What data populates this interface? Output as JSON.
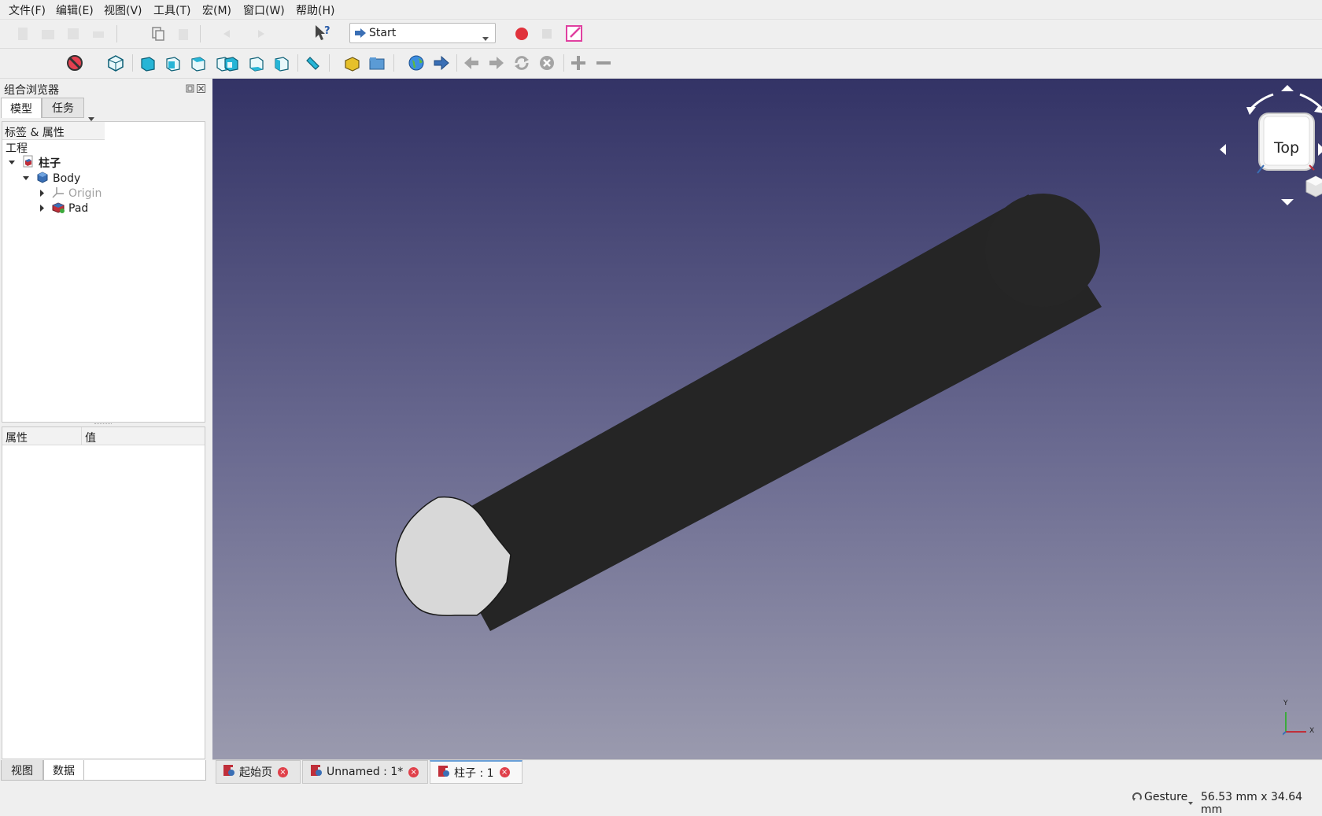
{
  "menu": [
    "文件(F)",
    "编辑(E)",
    "视图(V)",
    "工具(T)",
    "宏(M)",
    "窗口(W)",
    "帮助(H)"
  ],
  "toolbar": {
    "workbench": "Start"
  },
  "combo_view": {
    "title": "组合浏览器",
    "tabs": [
      "模型",
      "任务"
    ],
    "tree_header": "标签 & 属性",
    "tree_root": "工程",
    "tree": [
      {
        "label": "柱子",
        "bold": true
      },
      {
        "label": "Body"
      },
      {
        "label": "Origin",
        "disabled": true
      },
      {
        "label": "Pad"
      }
    ],
    "prop_columns": [
      "属性",
      "值"
    ],
    "bottom_tabs": [
      "视图",
      "数据"
    ]
  },
  "navcube": {
    "face": "Top"
  },
  "axis": {
    "y": "Y",
    "x": "X"
  },
  "doc_tabs": [
    {
      "label": "起始页"
    },
    {
      "label": "Unnamed : 1*"
    },
    {
      "label": "柱子 : 1",
      "active": true
    }
  ],
  "status": {
    "nav_style": "Gesture",
    "dimensions": "56.53 mm x 34.64 mm"
  },
  "colors": {
    "viewport_top": "#333366",
    "viewport_bottom": "#9a9aae",
    "cylinder_body": "#252525",
    "cylinder_face": "#d8d8d8",
    "record": "#e0323c"
  }
}
